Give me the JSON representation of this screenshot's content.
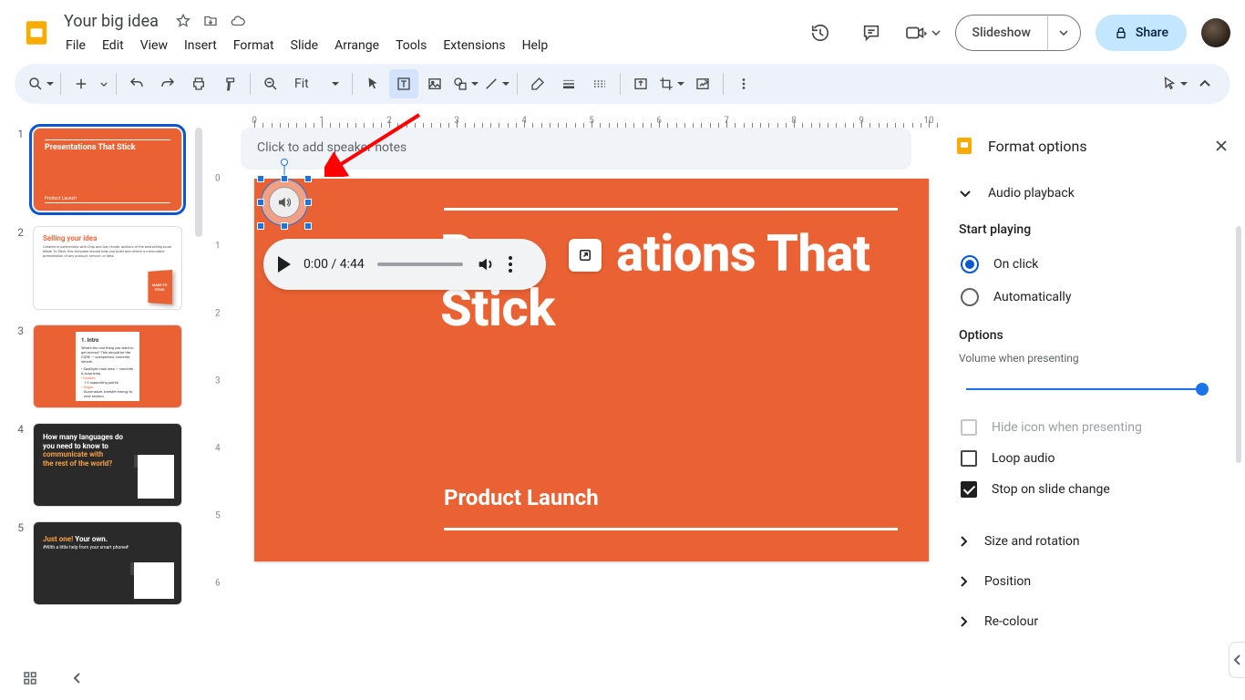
{
  "doc": {
    "title": "Your big idea"
  },
  "menu": {
    "file": "File",
    "edit": "Edit",
    "view": "View",
    "insert": "Insert",
    "format": "Format",
    "slide": "Slide",
    "arrange": "Arrange",
    "tools": "Tools",
    "extensions": "Extensions",
    "help": "Help"
  },
  "header_actions": {
    "slideshow": "Slideshow",
    "share": "Share"
  },
  "toolbar": {
    "fit": "Fit"
  },
  "thumbs": [
    {
      "num": "1",
      "title": "Presentations That Stick",
      "sub": "Product Launch"
    },
    {
      "num": "2",
      "title": "Selling your idea",
      "body": "Created in partnership with Chip and Dan Heath, authors of the bestselling book Made To Stick, this template should help you build and deliver a memorable presentation of any product, service, or idea.",
      "book": "MADE TO STICK"
    },
    {
      "num": "3",
      "title": "1. Intro",
      "line1": "What's the one thing you want to get across? This should be the CORE — unexpected, concrete, simple.",
      "b1": "Spotlight main idea — concrete & surprising",
      "b2": "Expand",
      "b3": "1-2 supporting points",
      "b4": "Segue",
      "b5": "Summarize, transfer energy to next section"
    },
    {
      "num": "4",
      "l1": "How many languages do",
      "l2": "you need to know to",
      "l3": "communicate with",
      "l4": "the rest of the world?"
    },
    {
      "num": "5",
      "l1": "Just one!",
      "l2": " Your own.",
      "sub": "#With a little help from your smart phone#"
    }
  ],
  "slide": {
    "title1": "Pr",
    "title_rest": "ations That",
    "title2": "Stick",
    "sub": "Product Launch"
  },
  "audio": {
    "time": "0:00 / 4:44"
  },
  "notes": {
    "placeholder": "Click to add speaker notes"
  },
  "sidepanel": {
    "title": "Format options",
    "sections": {
      "audio_playback": "Audio playback",
      "size_rotation": "Size and rotation",
      "position": "Position",
      "recolour": "Re-colour"
    },
    "start_playing": "Start playing",
    "on_click": "On click",
    "automatically": "Automatically",
    "options": "Options",
    "vol_label": "Volume when presenting",
    "hide_icon": "Hide icon when presenting",
    "loop": "Loop audio",
    "stop_change": "Stop on slide change"
  }
}
